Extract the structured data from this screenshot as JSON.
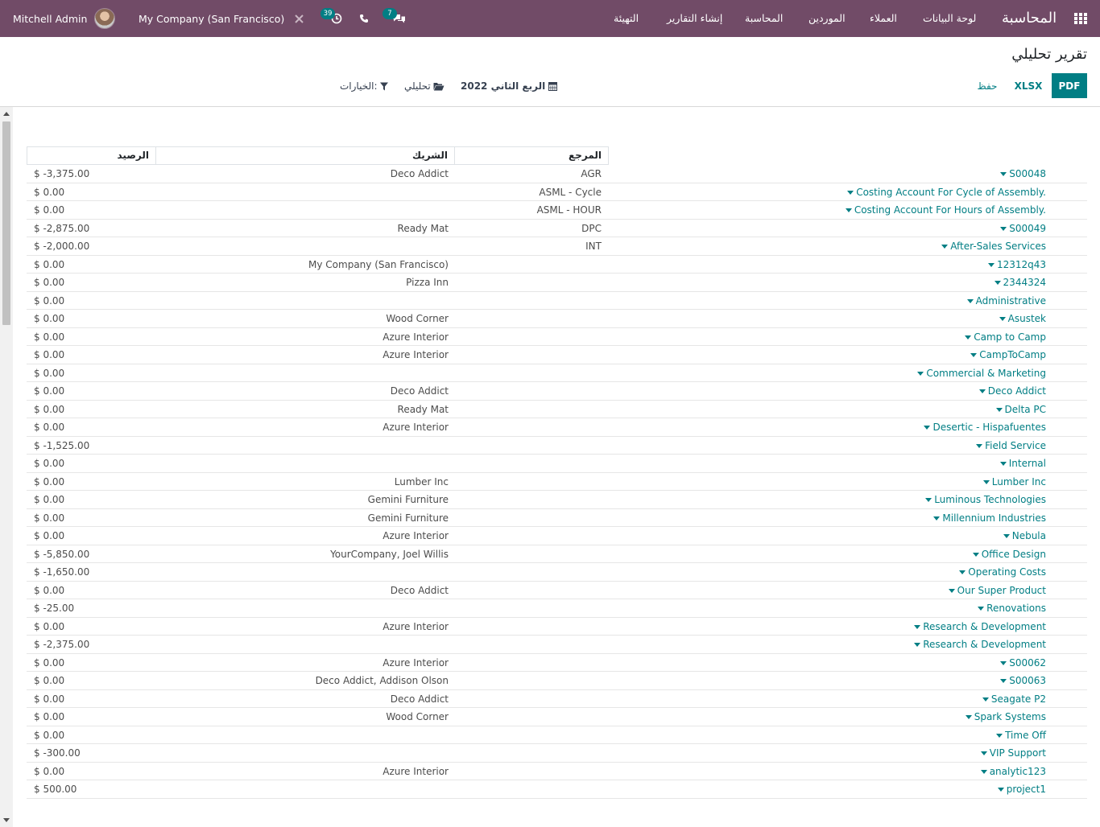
{
  "navbar": {
    "user_name": "Mitchell Admin",
    "company": "My Company (San Francisco)",
    "activity_count": "39",
    "message_count": "7",
    "brand": "المحاسبة",
    "menu": [
      "لوحة البيانات",
      "العملاء",
      "الموردين",
      "المحاسبة",
      "إنشاء التقارير",
      "التهيئة"
    ]
  },
  "control_panel": {
    "title": "تقرير تحليلي",
    "pdf_label": "PDF",
    "xlsx_label": "XLSX",
    "save_label": "حفظ",
    "date_filter": "الربع الثاني 2022",
    "analytic_filter": "تحليلي",
    "options_filter": "الخيارات:"
  },
  "table": {
    "headers": {
      "reference": "المرجع",
      "partner": "الشريك",
      "balance": "الرصيد"
    },
    "rows": [
      {
        "name": "S00048",
        "ref": "AGR",
        "partner": "Deco Addict",
        "balance": "$ -3,375.00"
      },
      {
        "name": "Costing Account For Cycle of Assembly.",
        "ref": "ASML - Cycle",
        "partner": "",
        "balance": "$ 0.00"
      },
      {
        "name": "Costing Account For Hours of Assembly.",
        "ref": "ASML - HOUR",
        "partner": "",
        "balance": "$ 0.00"
      },
      {
        "name": "S00049",
        "ref": "DPC",
        "partner": "Ready Mat",
        "balance": "$ -2,875.00"
      },
      {
        "name": "After-Sales Services",
        "ref": "INT",
        "partner": "",
        "balance": "$ -2,000.00"
      },
      {
        "name": "12312q43",
        "ref": "",
        "partner": "My Company (San Francisco)",
        "balance": "$ 0.00"
      },
      {
        "name": "2344324",
        "ref": "",
        "partner": "Pizza Inn",
        "balance": "$ 0.00"
      },
      {
        "name": "Administrative",
        "ref": "",
        "partner": "",
        "balance": "$ 0.00"
      },
      {
        "name": "Asustek",
        "ref": "",
        "partner": "Wood Corner",
        "balance": "$ 0.00"
      },
      {
        "name": "Camp to Camp",
        "ref": "",
        "partner": "Azure Interior",
        "balance": "$ 0.00"
      },
      {
        "name": "CampToCamp",
        "ref": "",
        "partner": "Azure Interior",
        "balance": "$ 0.00"
      },
      {
        "name": "Commercial & Marketing",
        "ref": "",
        "partner": "",
        "balance": "$ 0.00"
      },
      {
        "name": "Deco Addict",
        "ref": "",
        "partner": "Deco Addict",
        "balance": "$ 0.00"
      },
      {
        "name": "Delta PC",
        "ref": "",
        "partner": "Ready Mat",
        "balance": "$ 0.00"
      },
      {
        "name": "Desertic - Hispafuentes",
        "ref": "",
        "partner": "Azure Interior",
        "balance": "$ 0.00"
      },
      {
        "name": "Field Service",
        "ref": "",
        "partner": "",
        "balance": "$ -1,525.00"
      },
      {
        "name": "Internal",
        "ref": "",
        "partner": "",
        "balance": "$ 0.00"
      },
      {
        "name": "Lumber Inc",
        "ref": "",
        "partner": "Lumber Inc",
        "balance": "$ 0.00"
      },
      {
        "name": "Luminous Technologies",
        "ref": "",
        "partner": "Gemini Furniture",
        "balance": "$ 0.00"
      },
      {
        "name": "Millennium Industries",
        "ref": "",
        "partner": "Gemini Furniture",
        "balance": "$ 0.00"
      },
      {
        "name": "Nebula",
        "ref": "",
        "partner": "Azure Interior",
        "balance": "$ 0.00"
      },
      {
        "name": "Office Design",
        "ref": "",
        "partner": "YourCompany, Joel Willis",
        "balance": "$ -5,850.00"
      },
      {
        "name": "Operating Costs",
        "ref": "",
        "partner": "",
        "balance": "$ -1,650.00"
      },
      {
        "name": "Our Super Product",
        "ref": "",
        "partner": "Deco Addict",
        "balance": "$ 0.00"
      },
      {
        "name": "Renovations",
        "ref": "",
        "partner": "",
        "balance": "$ -25.00"
      },
      {
        "name": "Research & Development",
        "ref": "",
        "partner": "Azure Interior",
        "balance": "$ 0.00"
      },
      {
        "name": "Research & Development",
        "ref": "",
        "partner": "",
        "balance": "$ -2,375.00"
      },
      {
        "name": "S00062",
        "ref": "",
        "partner": "Azure Interior",
        "balance": "$ 0.00"
      },
      {
        "name": "S00063",
        "ref": "",
        "partner": "Deco Addict, Addison Olson",
        "balance": "$ 0.00"
      },
      {
        "name": "Seagate P2",
        "ref": "",
        "partner": "Deco Addict",
        "balance": "$ 0.00"
      },
      {
        "name": "Spark Systems",
        "ref": "",
        "partner": "Wood Corner",
        "balance": "$ 0.00"
      },
      {
        "name": "Time Off",
        "ref": "",
        "partner": "",
        "balance": "$ 0.00"
      },
      {
        "name": "VIP Support",
        "ref": "",
        "partner": "",
        "balance": "$ -300.00"
      },
      {
        "name": "analytic123",
        "ref": "",
        "partner": "Azure Interior",
        "balance": "$ 0.00"
      },
      {
        "name": "project1",
        "ref": "",
        "partner": "",
        "balance": "$ 500.00"
      }
    ]
  },
  "colors": {
    "navbar": "#714b67",
    "accent": "#017e84",
    "badge": "#017e84"
  }
}
